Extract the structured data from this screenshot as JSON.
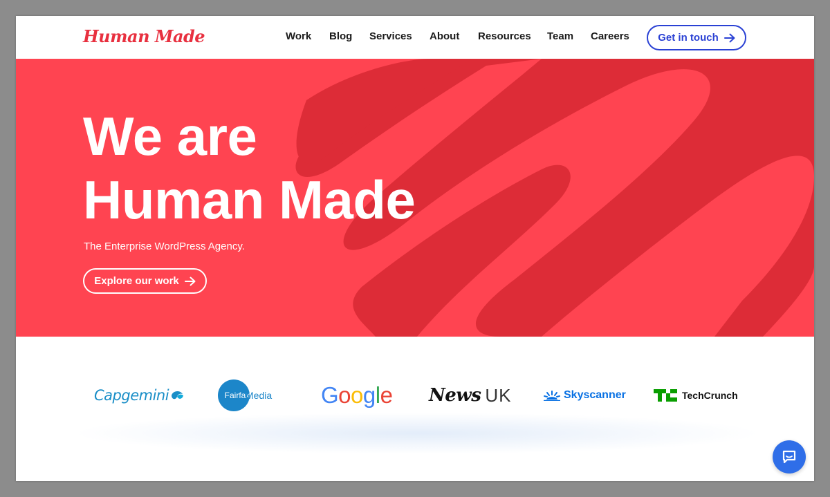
{
  "brand": {
    "logo_text": "Human Made",
    "accent": "#ff4451",
    "link_blue": "#2a41d4"
  },
  "nav": {
    "items": [
      "Work",
      "Blog",
      "Services",
      "About",
      "Resources",
      "Team",
      "Careers"
    ],
    "cta_label": "Get in touch"
  },
  "hero": {
    "title_line1": "We are",
    "title_line2": "Human Made",
    "subtitle": "The Enterprise WordPress Agency.",
    "button_label": "Explore our work",
    "background": "#ff4451",
    "scribble_color": "#dd2c37"
  },
  "clients": {
    "capgemini": "Capgemini",
    "fairfax_circle": "Fairfax",
    "fairfax_media": "Media",
    "google": [
      "G",
      "o",
      "o",
      "g",
      "l",
      "e"
    ],
    "newsuk_news": "News",
    "newsuk_uk": "UK",
    "skyscanner": "Skyscanner",
    "techcrunch": "TechCrunch"
  },
  "icons": {
    "arrow": "arrow-right-icon",
    "chat": "chat-bubble-icon"
  }
}
